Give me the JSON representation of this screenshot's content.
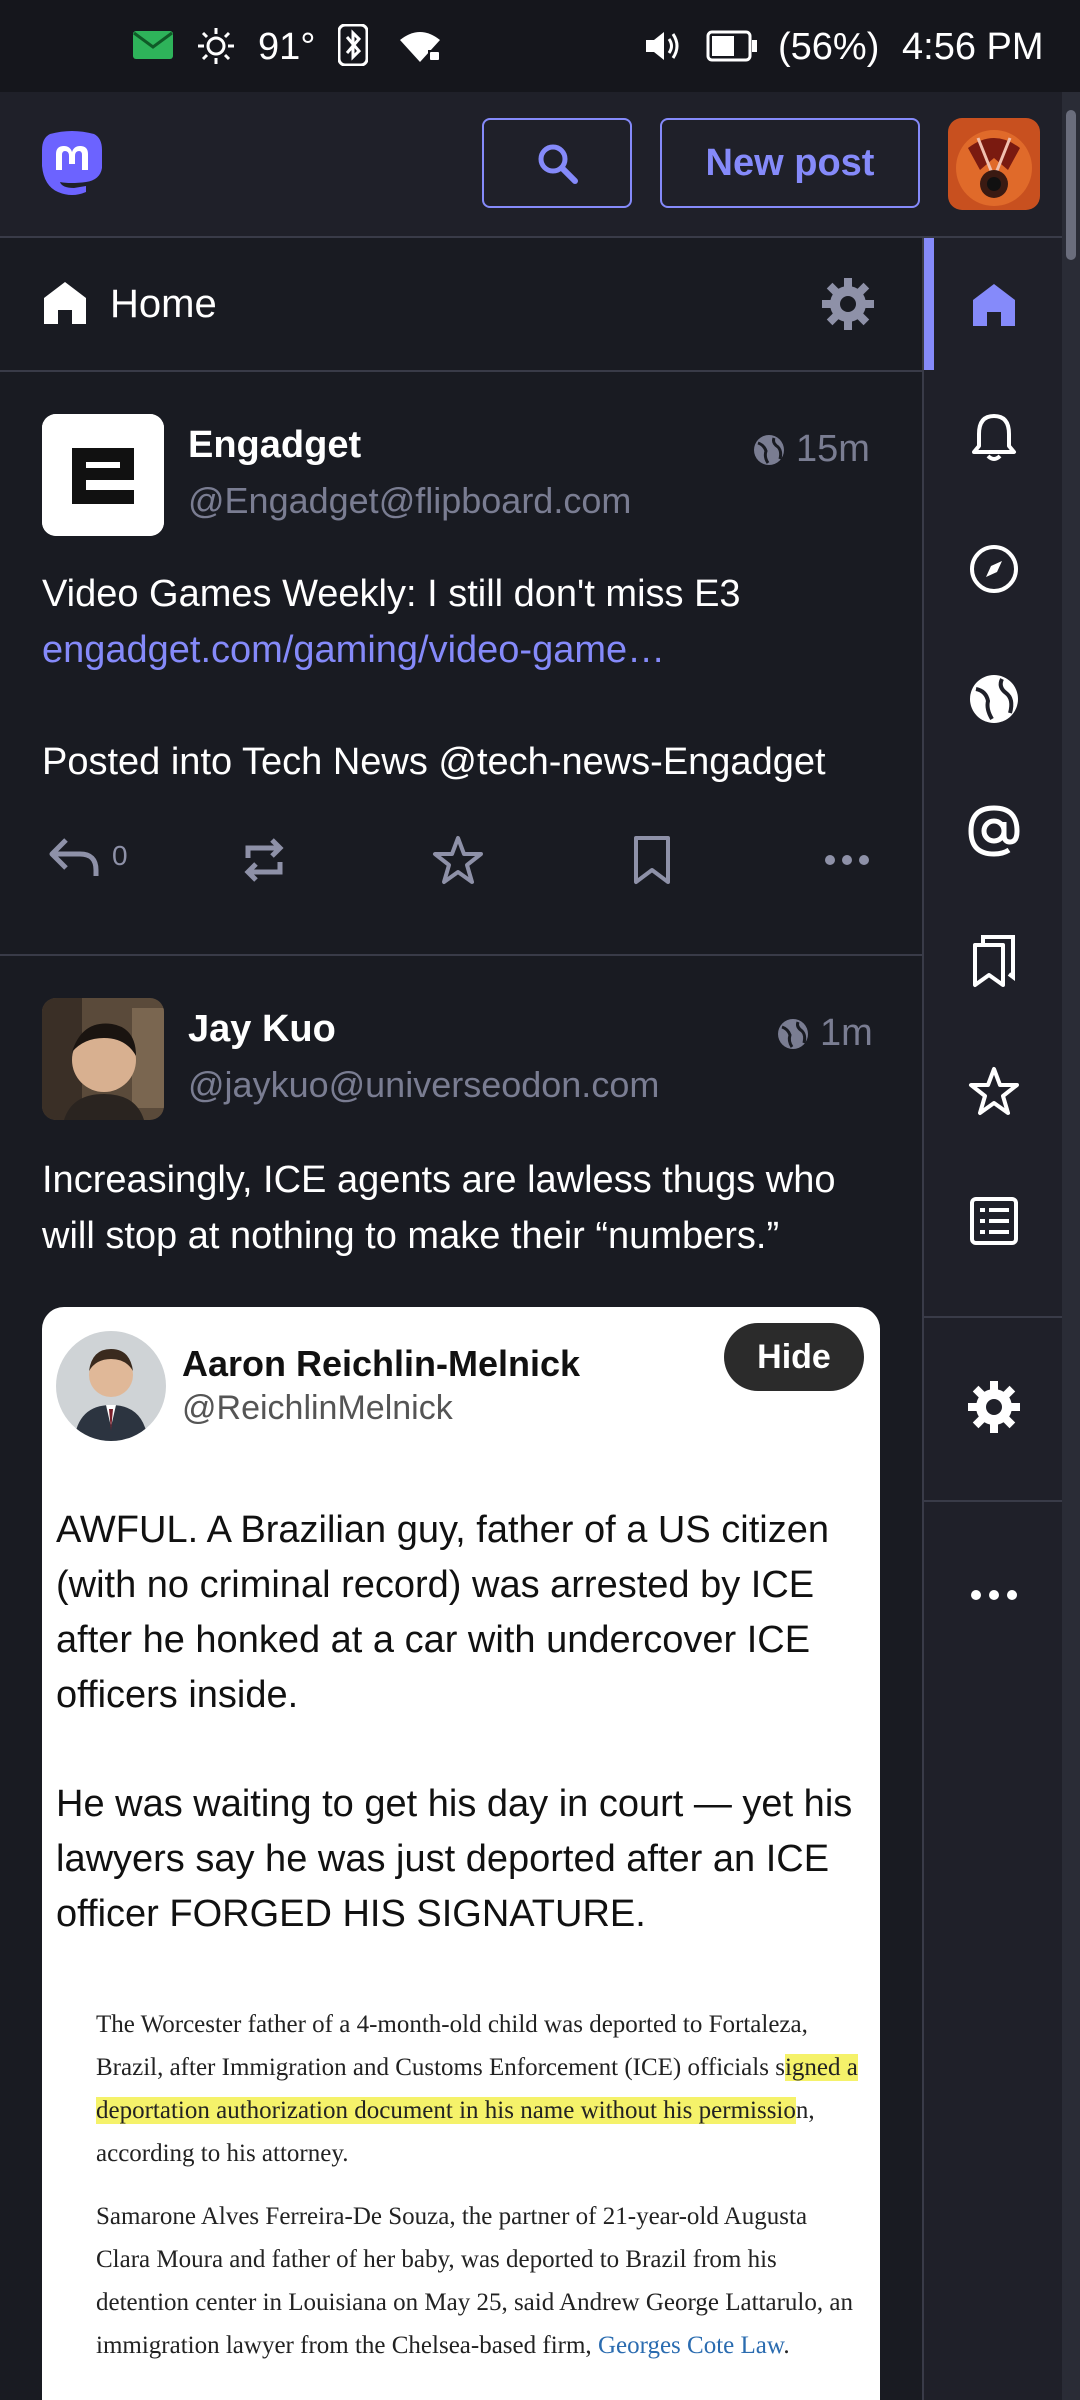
{
  "status_bar": {
    "temperature": "91°",
    "battery": "(56%)",
    "time": "4:56 PM"
  },
  "header": {
    "new_post_label": "New post",
    "icons": [
      "mastodon-logo",
      "search-icon",
      "avatar"
    ]
  },
  "column": {
    "title": "Home"
  },
  "nav": {
    "items": [
      "home",
      "notifications",
      "explore",
      "live-feeds",
      "mentions",
      "bookmarks",
      "favourites",
      "lists",
      "preferences",
      "more"
    ]
  },
  "posts": [
    {
      "author": "Engadget",
      "handle": "@Engadget@flipboard.com",
      "time": "15m",
      "text_line1": "Video Games Weekly: I still don't miss E3",
      "link": "engadget.com/gaming/video-game…",
      "text_line2": "Posted into Tech News @tech-news-Engadget",
      "reply_count": "0"
    },
    {
      "author": "Jay Kuo",
      "handle": "@jaykuo@universeodon.com",
      "time": "1m",
      "text": "Increasingly, ICE agents are lawless thugs who will stop at nothing to make their “numbers.”",
      "media": {
        "author": "Aaron Reichlin-Melnick",
        "handle": "@ReichlinMelnick",
        "hide_label": "Hide",
        "para1": "AWFUL. A Brazilian guy, father of a US citizen (with no criminal record) was arrested by ICE after he honked at a car with undercover ICE officers inside.",
        "para2": "He was waiting to get his day in court — yet his lawyers say he was just deported after an ICE officer FORGED HIS SIGNATURE.",
        "news_p1_a": "The Worcester father of a 4-month-old child was deported to Fortaleza, Brazil, after Immigration and Customs Enforcement (ICE) officials s",
        "news_p1_hl": "igned a deportation authorization document in his name without his permissio",
        "news_p1_b": "n, according to his attorney.",
        "news_p2_a": "Samarone Alves Ferreira-De Souza, the partner of 21-year-old Augusta Clara Moura and father of her baby, was deported to Brazil from his detention center in Louisiana on May 25, said Andrew George Lattarulo, an immigration lawyer from the Chelsea-based firm, ",
        "news_p2_link": "Georges Cote Law",
        "news_p2_b": "."
      }
    }
  ],
  "colors": {
    "accent": "#858afa",
    "background": "#191b22",
    "panel": "#1f2029",
    "muted": "#7a7d92"
  }
}
